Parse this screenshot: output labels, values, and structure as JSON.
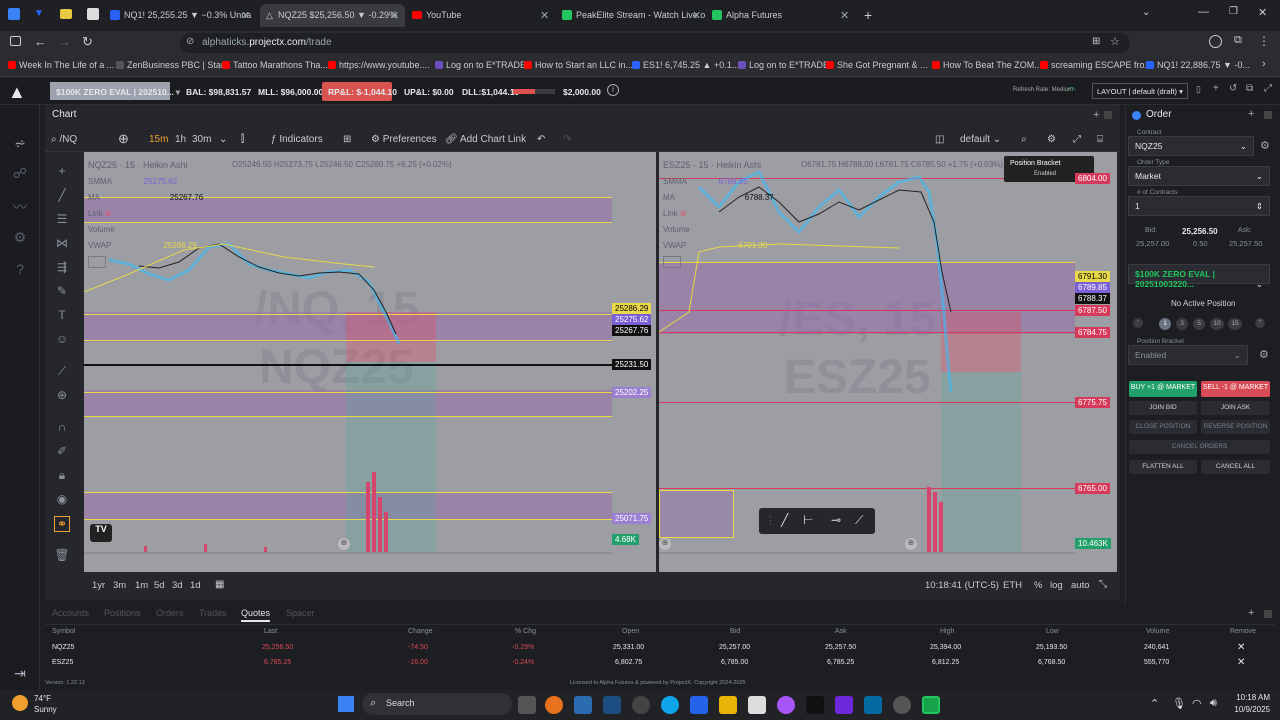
{
  "browser": {
    "tabs": [
      {
        "label": "NQ1! 25,255.25 ▼ −0.3% Unna",
        "active": false,
        "icon_color": "#2962ff"
      },
      {
        "label": "NQZ25 $25,256.50 ▼ -0.29%",
        "active": true,
        "icon_color": "#9ca3af"
      },
      {
        "label": "YouTube",
        "active": false,
        "icon_color": "#ff0000"
      },
      {
        "label": "PeakElite Stream - Watch Live o",
        "active": false,
        "icon_color": "#22c55e"
      },
      {
        "label": "Alpha Futures",
        "active": false,
        "icon_color": "#22c55e"
      }
    ],
    "url_host": "alphaticks.",
    "url_domain": "projectx.com",
    "url_path": "/trade",
    "bookmarks": [
      {
        "label": "Week In The Life of a ...",
        "color": "#ff0000"
      },
      {
        "label": "ZenBusiness PBC | Star...",
        "color": "#222222"
      },
      {
        "label": "Tattoo Marathons Tha...",
        "color": "#ff0000"
      },
      {
        "label": "https://www.youtube....",
        "color": "#ff0000"
      },
      {
        "label": "Log on to E*TRADE",
        "color": "#6b4fbb"
      },
      {
        "label": "How to Start an LLC in...",
        "color": "#ff0000"
      },
      {
        "label": "ES1! 6,745.25 ▲ +0.1...",
        "color": "#2962ff"
      },
      {
        "label": "Log on to E*TRADE",
        "color": "#6b4fbb"
      },
      {
        "label": "She Got Pregnant & ...",
        "color": "#ff0000"
      },
      {
        "label": "How To Beat The ZOM...",
        "color": "#ff0000"
      },
      {
        "label": "screaming ESCAPE fro...",
        "color": "#ff0000"
      },
      {
        "label": "NQ1! 22,886.75 ▼ -0...",
        "color": "#2962ff"
      }
    ]
  },
  "app": {
    "account": "$100K ZERO EVAL | 202510...",
    "bal": "BAL: $98,831.57",
    "mll": "MLL: $96,000.00",
    "rpl": "RP&L: $-1,044.10",
    "upl": "UP&L: $0.00",
    "dll": "DLL:$1,044.10",
    "dll_limit": "$2,000.00",
    "dll_progress": 0.52,
    "refresh": "Refresh Rate: Medium",
    "layout": "LAYOUT | default (draft)"
  },
  "chart_toolbar": {
    "title": "Chart",
    "symbol": "/NQ",
    "intervals": [
      "15m",
      "1h",
      "30m"
    ],
    "active_interval": "15m",
    "indicators": "Indicators",
    "preferences": "Preferences",
    "alert": "Add Chart Link",
    "layout": "default"
  },
  "left_chart": {
    "symbol_line": "NQZ25 · 15 · Heikin Ashi",
    "ohlc": "O25246.50  H25273.75  L25246.50  C25260.75  +6.25 (+0.02%)",
    "watermark1": "/NQ, 15",
    "watermark2": "NQZ25",
    "legend": [
      {
        "label": "SMMA",
        "value": "25275.62"
      },
      {
        "label": "MA",
        "value": "25267.76"
      },
      {
        "label": "Link",
        "value": ""
      },
      {
        "label": "Volume",
        "value": ""
      },
      {
        "label": "VWAP",
        "value": "25286.29"
      }
    ],
    "price_labels": [
      {
        "text": "25286.29",
        "bg": "#e8d84a",
        "fg": "#000"
      },
      {
        "text": "25275.62",
        "bg": "#7b5fd4",
        "fg": "#fff"
      },
      {
        "text": "25267.76",
        "bg": "#111",
        "fg": "#fff"
      },
      {
        "text": "25231.50",
        "bg": "#111",
        "fg": "#fff"
      },
      {
        "text": "25202.25",
        "bg": "#9b7fd0",
        "fg": "#fff"
      },
      {
        "text": "25071.75",
        "bg": "#9b7fd0",
        "fg": "#fff"
      },
      {
        "text": "4.68K",
        "bg": "#22a06b",
        "fg": "#fff"
      }
    ]
  },
  "right_chart": {
    "symbol_line": "ESZ25 · 15 · Heikin Ashi",
    "ohlc": "O6781.75  H6788.00  L6781.75  C6785.50  +1.75 (+0.03%)",
    "watermark1": "/ES, 15",
    "watermark2": "ESZ25",
    "legend_values": [
      "6789.85",
      "6788.37",
      "6791.30"
    ],
    "tooltip_title": "Position Bracket",
    "tooltip_sub": "Enabled",
    "price_labels": [
      {
        "text": "6804.00",
        "bg": "#d63a5a",
        "fg": "#fff"
      },
      {
        "text": "6791.30",
        "bg": "#e8d84a",
        "fg": "#000"
      },
      {
        "text": "6789.85",
        "bg": "#7b5fd4",
        "fg": "#fff"
      },
      {
        "text": "6788.37",
        "bg": "#111",
        "fg": "#fff"
      },
      {
        "text": "6787.50",
        "bg": "#d63a5a",
        "fg": "#fff"
      },
      {
        "text": "6784.75",
        "bg": "#d63a5a",
        "fg": "#fff"
      },
      {
        "text": "6775.75",
        "bg": "#d63a5a",
        "fg": "#fff"
      },
      {
        "text": "6765.00",
        "bg": "#d63a5a",
        "fg": "#fff"
      },
      {
        "text": "10.463K",
        "bg": "#22a06b",
        "fg": "#fff"
      }
    ]
  },
  "bottom_toolbar": {
    "ranges": [
      "1yr",
      "3m",
      "1m",
      "5d",
      "3d",
      "1d"
    ],
    "time": "10:18:41 (UTC-5)",
    "session": "ETH",
    "pct": "%",
    "log": "log",
    "auto": "auto"
  },
  "order_panel": {
    "title": "Order",
    "contract_label": "Contract",
    "contract": "NQZ25",
    "order_type_label": "Order Type",
    "order_type": "Market",
    "contracts_label": "# of Contracts",
    "contracts": "1",
    "bid_label": "Bid:",
    "bid": "25,257.00",
    "last": "25,256.50",
    "spread": "0.50",
    "ask_label": "Ask:",
    "ask": "25,257.50",
    "account": "$100K ZERO EVAL | 20251003220...",
    "no_position": "No Active Position",
    "qty_buttons": [
      "1",
      "3",
      "5",
      "10",
      "15"
    ],
    "bracket_label": "Position Bracket",
    "bracket": "Enabled",
    "buy": "BUY +1 @ MARKET",
    "sell": "SELL -1 @ MARKET",
    "join_bid": "JOIN BID",
    "join_ask": "JOIN ASK",
    "close_position": "CLOSE POSITION",
    "reverse_position": "REVERSE POSITION",
    "cancel_orders": "CANCEL ORDERS",
    "flatten_all": "FLATTEN ALL",
    "cancel_all": "CANCEL ALL"
  },
  "bottom_panel": {
    "tabs": [
      "Accounts",
      "Positions",
      "Orders",
      "Trades",
      "Quotes",
      "Spacer"
    ],
    "active_tab": "Quotes",
    "columns": [
      "Symbol",
      "Last",
      "Change",
      "% Chg",
      "Open",
      "Bid",
      "Ask",
      "High",
      "Low",
      "Volume",
      "Remove"
    ],
    "rows": [
      {
        "symbol": "NQZ25",
        "last": "25,256.50",
        "change": "-74.50",
        "pct": "-0.29%",
        "open": "25,331.00",
        "bid": "25,257.00",
        "ask": "25,257.50",
        "high": "25,394.00",
        "low": "25,193.50",
        "volume": "240,641"
      },
      {
        "symbol": "ESZ25",
        "last": "6,785.25",
        "change": "-16.00",
        "pct": "-0.24%",
        "open": "6,802.75",
        "bid": "6,785.00",
        "ask": "6,785.25",
        "high": "6,812.25",
        "low": "6,768.50",
        "volume": "555,770"
      }
    ],
    "version": "Version: 1.22.13",
    "license": "Licensed to Alpha Futures & powered by ProjectX. Copyright 2024-2025"
  },
  "taskbar": {
    "weather_temp": "74°F",
    "weather_desc": "Sunny",
    "search": "Search",
    "time": "10:18 AM",
    "date": "10/9/2025"
  }
}
